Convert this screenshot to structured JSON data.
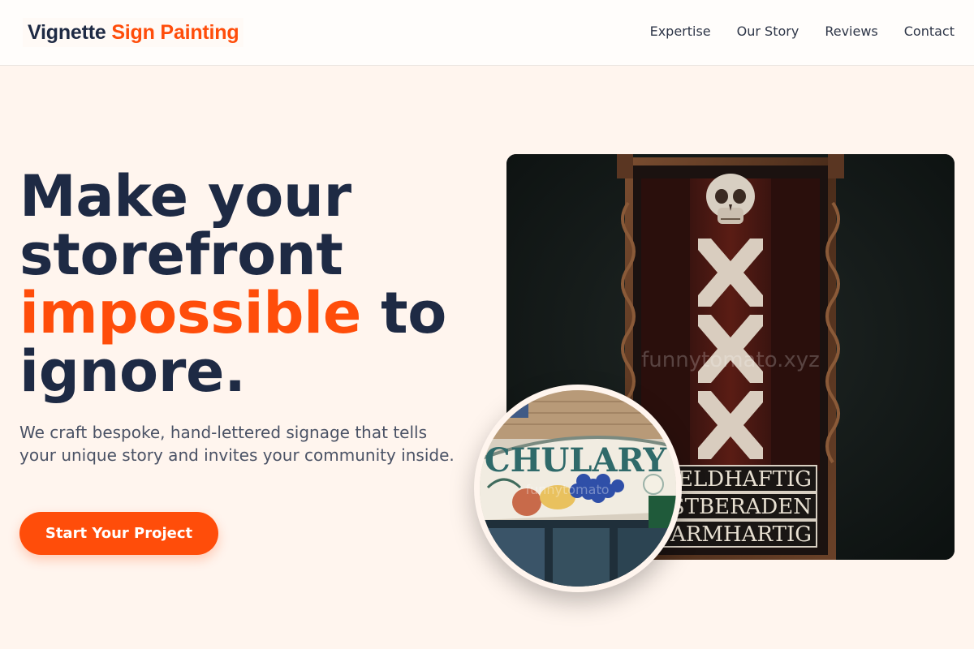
{
  "brand": {
    "name_part1": "Vignette",
    "name_part2": "Sign Painting"
  },
  "nav": {
    "items": [
      "Expertise",
      "Our Story",
      "Reviews",
      "Contact"
    ]
  },
  "hero": {
    "title_line1": "Make your",
    "title_line2": "storefront",
    "title_accent": "impossible",
    "title_after_accent": " to",
    "title_line4": "ignore.",
    "subtitle": "We craft bespoke, hand-lettered signage that tells your unique story and invites your community inside.",
    "cta_label": "Start Your Project"
  },
  "photo_main": {
    "sign_lines": [
      "ELDHAFTIG",
      "STBERADEN",
      "ARMHARTIG"
    ],
    "watermark": "funnytomato.xyz"
  },
  "photo_inset": {
    "sign_text": "CHULARY",
    "watermark": "funnytomato"
  },
  "colors": {
    "accent": "#ff4d0a",
    "navy": "#1e2a44",
    "background": "#fff5ee"
  }
}
